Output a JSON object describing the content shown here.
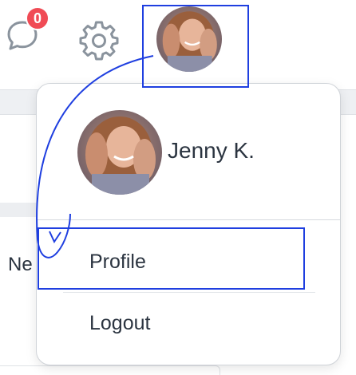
{
  "header": {
    "notifications": {
      "icon": "chat-bubble-icon",
      "badge_count": "0",
      "badge_color": "#f04b55"
    },
    "settings": {
      "icon": "gear-icon"
    },
    "user_avatar": {
      "icon": "avatar-photo"
    }
  },
  "page": {
    "partial_text": "Ne"
  },
  "dropdown": {
    "user_name": "Jenny K.",
    "items": [
      {
        "label": "Profile"
      },
      {
        "label": "Logout"
      }
    ]
  },
  "annotation": {
    "highlight_color": "#1f3fe0"
  }
}
